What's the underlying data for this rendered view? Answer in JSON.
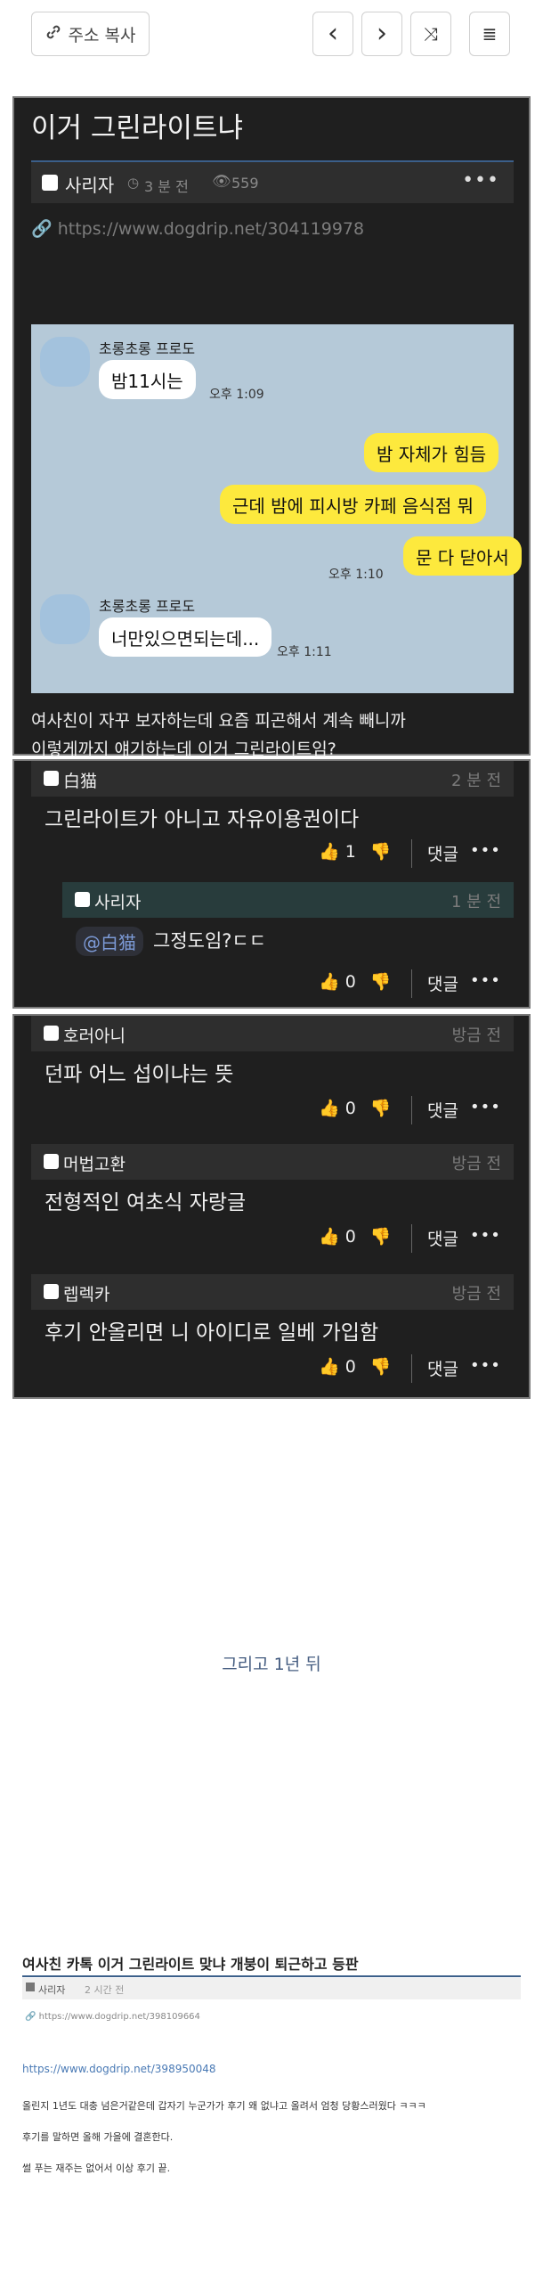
{
  "toolbar": {
    "copy_label": "주소 복사",
    "prev_icon": "‹",
    "next_icon": "›",
    "shuffle_icon": "⤨",
    "list_icon": "≣"
  },
  "post": {
    "title": "이거 그린라이트냐",
    "author": "사리자",
    "time": "3 분 전",
    "views": "559",
    "link": "https://www.dogdrip.net/304119978",
    "body_line1": "여사친이 자꾸 보자하는데 요즘 피곤해서 계속 빼니까",
    "body_line2": "이렇게까지 얘기하는데 이거 그린라이트임?"
  },
  "chat": {
    "name1": "초롱초롱 프로도",
    "msg1": "밤11시는",
    "time1": "오후 1:09",
    "me1": "밤 자체가 힘듬",
    "me2": "근데 밤에 피시방 카페 음식점 뭐",
    "me3": "문 다 닫아서",
    "time2": "오후 1:10",
    "name2": "초롱초롱 프로도",
    "msg2": "너만있으면되는데...",
    "time3": "오후 1:11"
  },
  "comments": [
    {
      "author": "白猫",
      "time": "2 분 전",
      "text": "그린라이트가 아니고 자유이용권이다",
      "likes": "1",
      "reply_label": "댓글"
    },
    {
      "author": "사리자",
      "time": "1 분 전",
      "mention": "@白猫",
      "text": "그정도임?ㄷㄷ",
      "likes": "0",
      "reply_label": "댓글"
    },
    {
      "author": "호러아니",
      "time": "방금 전",
      "text": "던파 어느 섭이냐는 뜻",
      "likes": "0",
      "reply_label": "댓글"
    },
    {
      "author": "머법고환",
      "time": "방금 전",
      "text": "전형적인 여초식 자랑글",
      "likes": "0",
      "reply_label": "댓글"
    },
    {
      "author": "렙렉카",
      "time": "방금 전",
      "text": "후기 안올리면 니 아이디로 일베 가입함",
      "likes": "0",
      "reply_label": "댓글"
    }
  ],
  "caption": "그리고 1년 뒤",
  "followup": {
    "title": "여사친 카톡 이거 그린라이트 맞냐 개붕이 퇴근하고 등판",
    "author": "사리자",
    "time": "2 시간 전",
    "link1": "https://www.dogdrip.net/398109664",
    "link2": "https://www.dogdrip.net/398950048",
    "line1": "올린지 1년도 대충 넘은거같은데 갑자기 누군가가 후기 왜 없냐고 올려서 엄청 당황스러웠다 ㅋㅋㅋ",
    "line2": "후기를 말하면 올해 가을에 결혼한다.",
    "line3": "썰 푸는 재주는 없어서 이상 후기 끝."
  },
  "colors": {
    "accent": "#3b5f8a",
    "dark_bg": "#1f1f1f",
    "bar_bg": "#2e2e2e",
    "kakao_yellow": "#fde93d",
    "kakao_bg": "#b5c9d8"
  }
}
